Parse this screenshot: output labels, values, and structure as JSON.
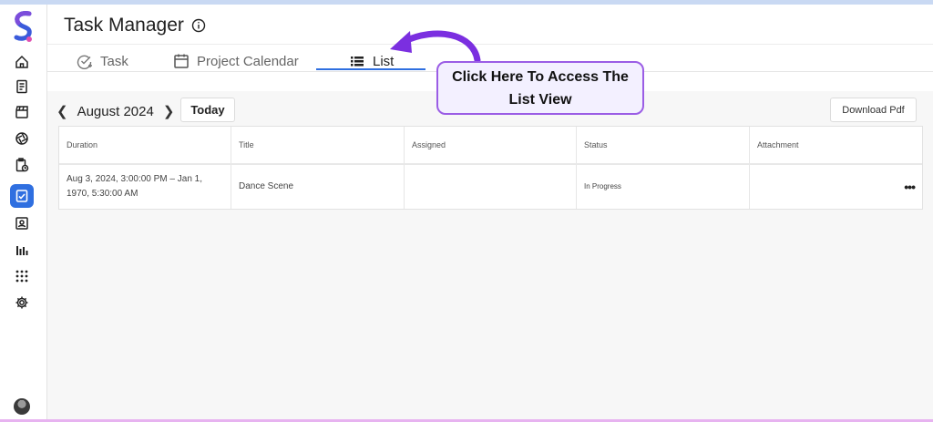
{
  "app": {
    "title": "Task Manager"
  },
  "tabs": [
    {
      "label": "Task",
      "icon": "task-check-icon"
    },
    {
      "label": "Project Calendar",
      "icon": "calendar-icon"
    },
    {
      "label": "List",
      "icon": "list-icon",
      "active": true
    }
  ],
  "sidebar": {
    "items": [
      {
        "icon": "home-icon"
      },
      {
        "icon": "document-icon"
      },
      {
        "icon": "clapperboard-icon"
      },
      {
        "icon": "aperture-icon"
      },
      {
        "icon": "clipboard-clock-icon"
      },
      {
        "icon": "task-list-icon",
        "active": true
      },
      {
        "icon": "contact-card-icon"
      },
      {
        "icon": "bar-chart-icon"
      },
      {
        "icon": "apps-grid-icon"
      },
      {
        "icon": "settings-icon"
      }
    ]
  },
  "toolbar": {
    "month": "August 2024",
    "today_label": "Today",
    "download_label": "Download Pdf"
  },
  "table": {
    "columns": [
      "Duration",
      "Title",
      "Assigned",
      "Status",
      "Attachment"
    ],
    "rows": [
      {
        "duration": "Aug 3, 2024, 3:00:00 PM – Jan 1, 1970, 5:30:00 AM",
        "title": "Dance Scene",
        "assigned": "",
        "status": "In Progress",
        "attachment": ""
      }
    ]
  },
  "callout": {
    "text": "Click Here To Access The List View"
  },
  "colors": {
    "accent": "#2f6fe0",
    "callout_border": "#9b5de5",
    "arrow": "#7b2fe0"
  }
}
